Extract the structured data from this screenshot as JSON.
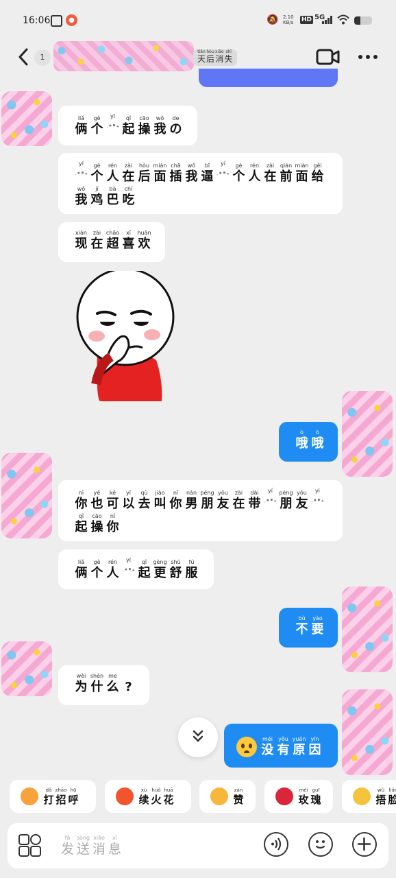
{
  "status_bar": {
    "time": "16:06",
    "net_speed_value": "2.10",
    "net_speed_unit": "KB/s",
    "hd": "HD",
    "network": "5G",
    "battery_level": 0.35
  },
  "header": {
    "unread_count": "1",
    "title_tail": [
      {
        "py": "tiān",
        "hz": "天"
      },
      {
        "py": "hòu",
        "hz": "后"
      },
      {
        "py": "xiāo",
        "hz": "消"
      },
      {
        "py": "shī",
        "hz": "失"
      }
    ]
  },
  "messages": [
    {
      "dir": "in",
      "chars": [
        {
          "py": "liǎ",
          "hz": "俩"
        },
        {
          "py": "gè",
          "hz": "个"
        },
        {
          "py": "yī",
          "hz": "~"
        },
        {
          "py": "qǐ",
          "hz": "起"
        },
        {
          "py": "cāo",
          "hz": "操"
        },
        {
          "py": "wǒ",
          "hz": "我"
        },
        {
          "py": "de",
          "hz": "の"
        }
      ]
    },
    {
      "dir": "in",
      "chars": [
        {
          "py": "yí",
          "hz": "~"
        },
        {
          "py": "gè",
          "hz": "个"
        },
        {
          "py": "rén",
          "hz": "人"
        },
        {
          "py": "zài",
          "hz": "在"
        },
        {
          "py": "hòu",
          "hz": "后"
        },
        {
          "py": "miàn",
          "hz": "面"
        },
        {
          "py": "chā",
          "hz": "插"
        },
        {
          "py": "wǒ",
          "hz": "我"
        },
        {
          "py": "bī",
          "hz": "逼"
        },
        {
          "py": "yí",
          "hz": "~"
        },
        {
          "py": "gè",
          "hz": "个"
        },
        {
          "py": "rén",
          "hz": "人"
        },
        {
          "py": "zài",
          "hz": "在"
        },
        {
          "py": "qián",
          "hz": "前"
        },
        {
          "py": "miàn",
          "hz": "面"
        },
        {
          "py": "gěi",
          "hz": "给"
        },
        {
          "py": "wǒ",
          "hz": "我"
        },
        {
          "py": "jī",
          "hz": "鸡"
        },
        {
          "py": "bā",
          "hz": "巴"
        },
        {
          "py": "chī",
          "hz": "吃"
        }
      ]
    },
    {
      "dir": "in",
      "chars": [
        {
          "py": "xiàn",
          "hz": "现"
        },
        {
          "py": "zài",
          "hz": "在"
        },
        {
          "py": "chāo",
          "hz": "超"
        },
        {
          "py": "xǐ",
          "hz": "喜"
        },
        {
          "py": "huān",
          "hz": "欢"
        }
      ]
    },
    {
      "dir": "out",
      "chars": [
        {
          "py": "ò",
          "hz": "哦"
        },
        {
          "py": "ò",
          "hz": "哦"
        }
      ]
    },
    {
      "dir": "in",
      "chars": [
        {
          "py": "nǐ",
          "hz": "你"
        },
        {
          "py": "yě",
          "hz": "也"
        },
        {
          "py": "kě",
          "hz": "可"
        },
        {
          "py": "yǐ",
          "hz": "以"
        },
        {
          "py": "qù",
          "hz": "去"
        },
        {
          "py": "jiào",
          "hz": "叫"
        },
        {
          "py": "nǐ",
          "hz": "你"
        },
        {
          "py": "nán",
          "hz": "男"
        },
        {
          "py": "péng",
          "hz": "朋"
        },
        {
          "py": "yǒu",
          "hz": "友"
        },
        {
          "py": "zài",
          "hz": "在"
        },
        {
          "py": "dài",
          "hz": "带"
        },
        {
          "py": "yí",
          "hz": "~"
        },
        {
          "py": "péng",
          "hz": "朋"
        },
        {
          "py": "yǒu",
          "hz": "友"
        },
        {
          "py": "yì",
          "hz": "~"
        },
        {
          "py": "qǐ",
          "hz": "起"
        },
        {
          "py": "cāo",
          "hz": "操"
        },
        {
          "py": "nǐ",
          "hz": "你"
        }
      ]
    },
    {
      "dir": "in",
      "chars": [
        {
          "py": "liǎ",
          "hz": "俩"
        },
        {
          "py": "gè",
          "hz": "个"
        },
        {
          "py": "rén",
          "hz": "人"
        },
        {
          "py": "yī",
          "hz": "~"
        },
        {
          "py": "qǐ",
          "hz": "起"
        },
        {
          "py": "gèng",
          "hz": "更"
        },
        {
          "py": "shū",
          "hz": "舒"
        },
        {
          "py": "fú",
          "hz": "服"
        }
      ]
    },
    {
      "dir": "out",
      "chars": [
        {
          "py": "bù",
          "hz": "不"
        },
        {
          "py": "yào",
          "hz": "要"
        }
      ]
    },
    {
      "dir": "in",
      "chars": [
        {
          "py": "wèi",
          "hz": "为"
        },
        {
          "py": "shén",
          "hz": "什"
        },
        {
          "py": "me",
          "hz": "么"
        },
        {
          "py": "",
          "hz": "?"
        }
      ]
    },
    {
      "dir": "out",
      "chars": [
        {
          "py": "méi",
          "hz": "没"
        },
        {
          "py": "yǒu",
          "hz": "有"
        },
        {
          "py": "yuán",
          "hz": "原"
        },
        {
          "py": "yīn",
          "hz": "因"
        }
      ]
    }
  ],
  "quick_replies": [
    {
      "icon": "greeting-icon",
      "color": "#f7a23b",
      "chars": [
        {
          "py": "dǎ",
          "hz": "打"
        },
        {
          "py": "zhāo",
          "hz": "招"
        },
        {
          "py": "hū",
          "hz": "呼"
        }
      ]
    },
    {
      "icon": "fire-icon",
      "color": "#f2542d",
      "chars": [
        {
          "py": "xù",
          "hz": "续"
        },
        {
          "py": "huǒ",
          "hz": "火"
        },
        {
          "py": "huā",
          "hz": "花"
        }
      ]
    },
    {
      "icon": "thumbs-up-icon",
      "color": "#f6b73c",
      "chars": [
        {
          "py": "zàn",
          "hz": "赞"
        }
      ]
    },
    {
      "icon": "rose-icon",
      "color": "#d9263a",
      "chars": [
        {
          "py": "méi",
          "hz": "玫"
        },
        {
          "py": "guī",
          "hz": "瑰"
        }
      ]
    },
    {
      "icon": "laugh-cry-icon",
      "color": "#f6c33c",
      "chars": [
        {
          "py": "wǔ",
          "hz": "捂"
        },
        {
          "py": "liǎn",
          "hz": "脸"
        }
      ]
    }
  ],
  "input": {
    "placeholder": [
      {
        "py": "fā",
        "hz": "发"
      },
      {
        "py": "sòng",
        "hz": "送"
      },
      {
        "py": "xiāo",
        "hz": "消"
      },
      {
        "py": "xī",
        "hz": "息"
      }
    ]
  },
  "colors": {
    "outgoing_bubble": "#1e8cf3",
    "partial_bubble": "#5f77f5",
    "background": "#eeeeee"
  }
}
